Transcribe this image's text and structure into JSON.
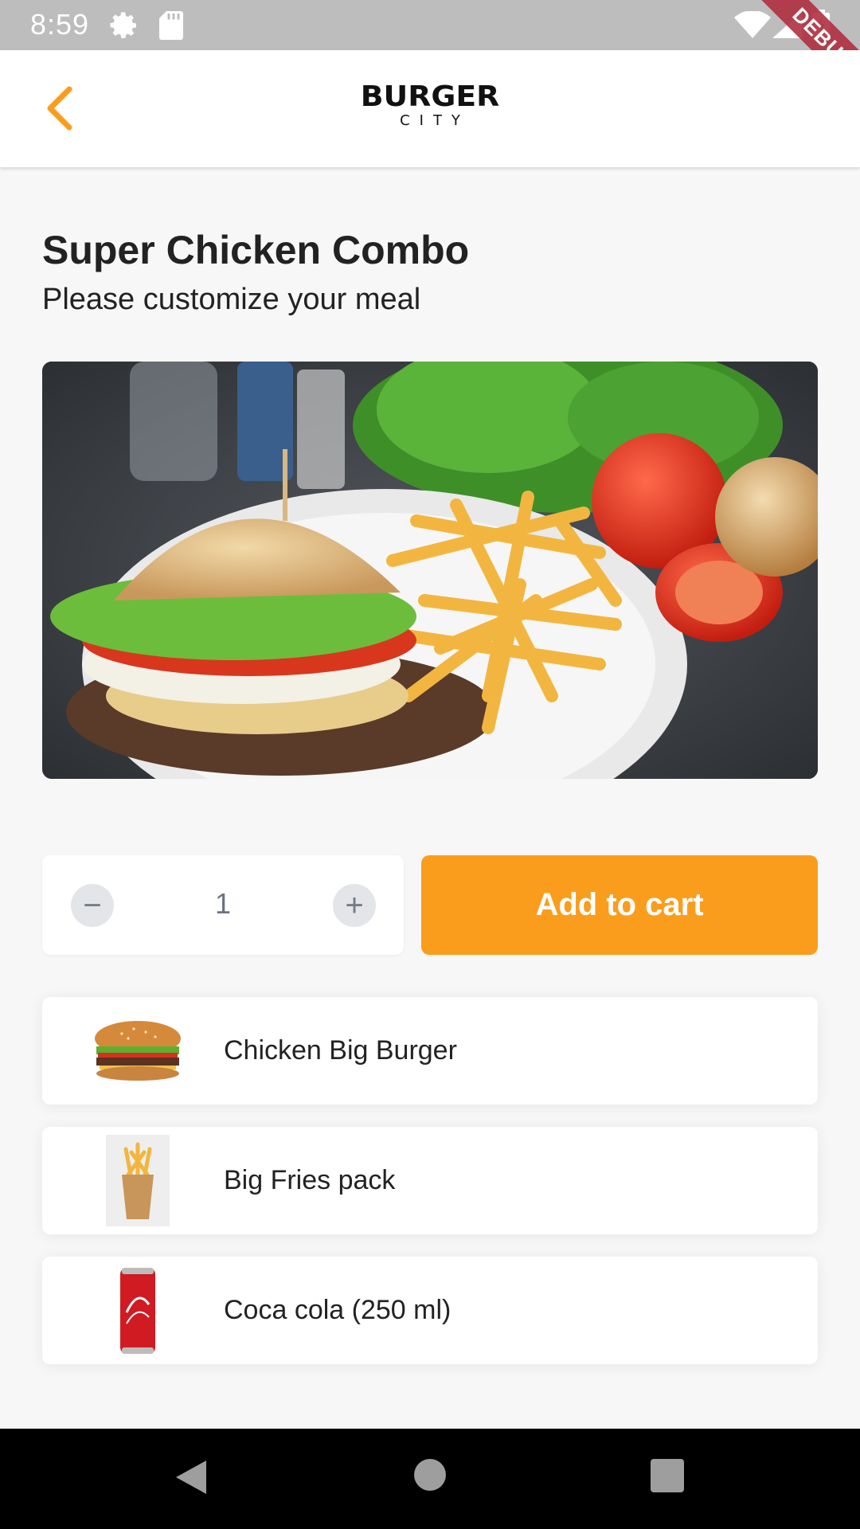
{
  "status_bar": {
    "time": "8:59"
  },
  "debug_banner": "DEBUG",
  "app_bar": {
    "logo_main": "BURGER",
    "logo_sub": "CITY"
  },
  "meal": {
    "title": "Super Chicken Combo",
    "subtitle": "Please customize your meal"
  },
  "quantity": {
    "value": "1",
    "minus": "−",
    "plus": "+"
  },
  "add_to_cart_label": "Add to cart",
  "items": [
    {
      "label": "Chicken Big Burger",
      "icon": "burger-icon"
    },
    {
      "label": "Big Fries pack",
      "icon": "fries-icon"
    },
    {
      "label": "Coca cola (250 ml)",
      "icon": "cola-can-icon"
    }
  ],
  "colors": {
    "accent": "#fb9d1c",
    "background": "#f7f7f7",
    "status_bar": "#bdbdbd"
  }
}
